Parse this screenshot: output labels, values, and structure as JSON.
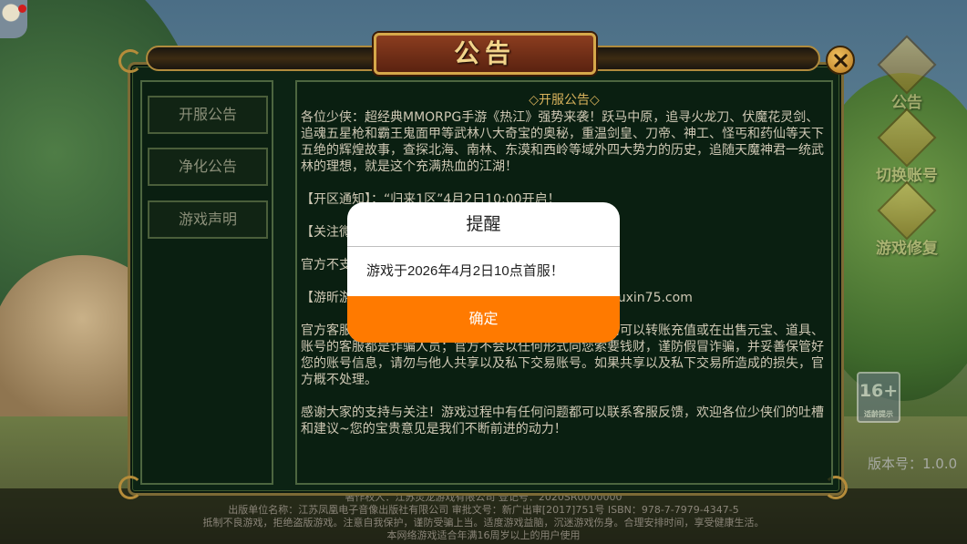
{
  "panel": {
    "title": "公告",
    "tabs": [
      {
        "label": "开服公告"
      },
      {
        "label": "净化公告"
      },
      {
        "label": "游戏声明"
      }
    ],
    "content_title": "◇开服公告◇",
    "paragraphs": [
      "各位少侠：超经典MMORPG手游《热江》强势来袭！跃马中原，追寻火龙刀、伏魔花灵剑、追魂五星枪和霸王鬼面甲等武林八大奇宝的奥秘，重温剑皇、刀帝、神工、怪丐和药仙等天下五绝的辉煌故事，查探北海、南林、东漠和西岭等域外四大势力的历史，追随天魔神君一统武林的理想，就是这个充满热血的江湖！",
      "【开区通知】：“归来1区”4月2日10:00开启！",
      "【关注微                                                   inrxjh）了解游戏最新资讯，领取关注礼包",
      "官方不支                                                   方一律不受理。祝您游戏愉快！",
      "【游昕游                                                   保驾护航！下载方式：前往游昕微信公众号                                               youxin75.com",
      "官方客服不会以任何形式向您索要账号密码或钱财，任何可以转账充值或在出售元宝、道具、账号的客服都是诈骗人员；官方不会以任何形式向您索要钱财，谨防假冒诈骗，并妥善保管好您的账号信息，请勿与他人共享以及私下交易账号。如果共享以及私下交易所造成的损失，官方概不处理。",
      "感谢大家的支持与关注！游戏过程中有任何问题都可以联系客服反馈，欢迎各位少侠们的吐槽和建议~您的宝贵意见是我们不断前进的动力！"
    ]
  },
  "side_menu": [
    {
      "label": "公告"
    },
    {
      "label": "切换账号"
    },
    {
      "label": "游戏修复"
    }
  ],
  "age_badge": {
    "rating": "16+",
    "sub": "适龄提示"
  },
  "version": "版本号：1.0.0",
  "footer": {
    "lines": [
      "著作权人：江苏灵龙游戏有限公司   登记号：2020SR0000000",
      "出版单位名称：江苏凤凰电子音像出版社有限公司   审批文号：新广出审[2017]751号   ISBN：978-7-7979-4347-5",
      "抵制不良游戏，拒绝盗版游戏。注意自我保护，谨防受骗上当。适度游戏益脑，沉迷游戏伤身。合理安排时间，享受健康生活。",
      "本网络游戏适合年满16周岁以上的用户使用"
    ]
  },
  "dialog": {
    "title": "提醒",
    "message": "游戏于2026年4月2日10点首服！",
    "confirm_label": "确定",
    "accent_color": "#ff7a00"
  }
}
